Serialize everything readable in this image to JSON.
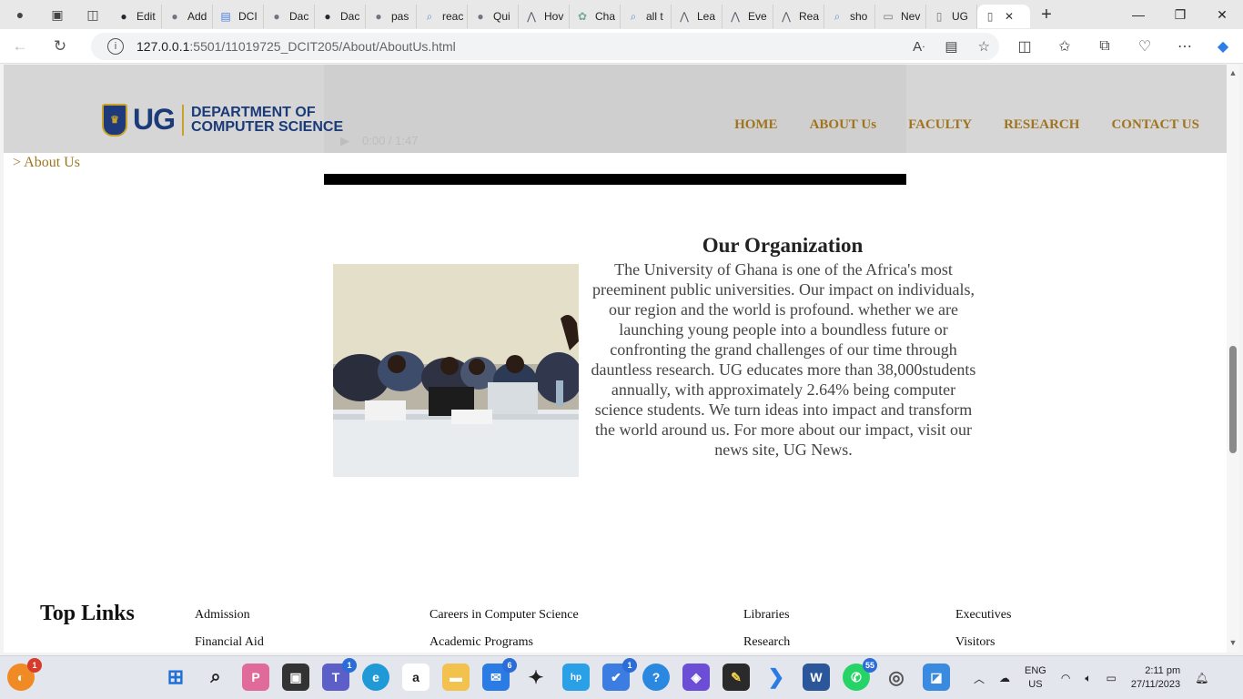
{
  "browser": {
    "tabs": [
      {
        "label": "Edit",
        "icon": "github-icon",
        "color": "#24292f"
      },
      {
        "label": "Add",
        "icon": "github-icon",
        "color": "#6e7681"
      },
      {
        "label": "DCI",
        "icon": "google-docs-icon",
        "color": "#4a7fe0"
      },
      {
        "label": "Dac",
        "icon": "github-icon",
        "color": "#6e7681"
      },
      {
        "label": "Dac",
        "icon": "github-icon",
        "color": "#24292f"
      },
      {
        "label": "pas",
        "icon": "github-icon",
        "color": "#6e7681"
      },
      {
        "label": "reac",
        "icon": "search-icon",
        "color": "#6b8cce"
      },
      {
        "label": "Qui",
        "icon": "github-icon",
        "color": "#6e7681"
      },
      {
        "label": "Hov",
        "icon": "arc-icon",
        "color": "#5b5b6b"
      },
      {
        "label": "Cha",
        "icon": "chatgpt-icon",
        "color": "#7aa89a"
      },
      {
        "label": "all t",
        "icon": "search-icon",
        "color": "#6b8cce"
      },
      {
        "label": "Lea",
        "icon": "arc-icon",
        "color": "#5b5b6b"
      },
      {
        "label": "Eve",
        "icon": "arc-icon",
        "color": "#5b5b6b"
      },
      {
        "label": "Rea",
        "icon": "arc-icon",
        "color": "#5b5b6b"
      },
      {
        "label": "sho",
        "icon": "search-icon",
        "color": "#6b8cce"
      },
      {
        "label": "Nev",
        "icon": "newtab-icon",
        "color": "#777777"
      },
      {
        "label": "UG",
        "icon": "page-icon",
        "color": "#777777"
      }
    ],
    "active_tab": {
      "label": "",
      "icon": "page-icon"
    },
    "url_host": "127.0.0.1",
    "url_path": ":5501/11019725_DCIT205/About/AboutUs.html"
  },
  "page": {
    "logo_text": "UG",
    "dept_line1": "DEPARTMENT OF",
    "dept_line2": "COMPUTER SCIENCE",
    "nav": [
      "HOME",
      "ABOUT Us",
      "FACULTY",
      "RESEARCH",
      "CONTACT US"
    ],
    "video_time": "0:00 / 1:47",
    "breadcrumb": "> About Us",
    "org_title": "Our Organization",
    "org_text": "The University of Ghana is one of the Africa's most preeminent public universities. Our impact on individuals, our region and the world is profound. whether we are launching young people into a boundless future or confronting the grand challenges of our time through dauntless research. UG educates more than 38,000students annually, with approximately 2.64% being computer science students. We turn ideas into impact and transform the world around us. For more about our impact, visit our news site, UG News.",
    "top_links_title": "Top Links",
    "top_links": [
      [
        "Admission",
        "Careers in Computer Science",
        "Libraries",
        "Executives"
      ],
      [
        "Financial Aid",
        "Academic Programs",
        "Research",
        "Visitors"
      ]
    ]
  },
  "taskbar": {
    "badges": {
      "copilot_notify": "1",
      "teams": "1",
      "mail": "6",
      "todo": "1",
      "whatsapp": "55"
    },
    "lang_line1": "ENG",
    "lang_line2": "US",
    "time": "2:11 pm",
    "date": "27/11/2023"
  },
  "colors": {
    "nav_gold": "#a0741e",
    "ug_blue": "#1a3a78",
    "header_gray": "#d6d6d6"
  }
}
